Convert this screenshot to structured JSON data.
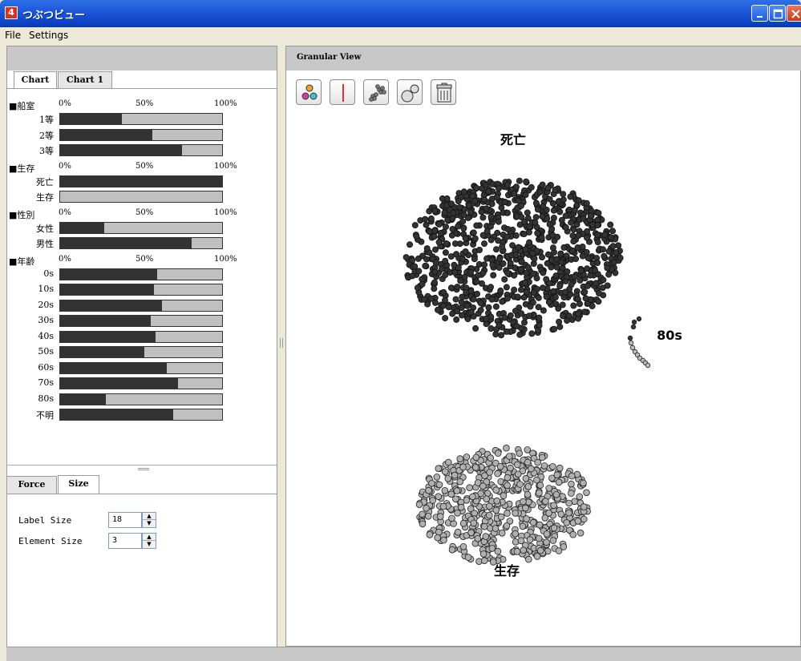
{
  "window": {
    "title": "つぶつビュー",
    "icon_glyph": "4"
  },
  "menu": [
    "File",
    "Settings"
  ],
  "chart_tabs": [
    "Chart",
    "Chart 1"
  ],
  "axis_ticks": [
    "0%",
    "50%",
    "100%"
  ],
  "colors": {
    "dark": "#333333",
    "light": "#c0c0c0",
    "accent_red": "#d9302a",
    "titlebar_blue": "#0a3fc0"
  },
  "chart_data": {
    "type": "bar",
    "stacked_percent": true,
    "xlim": [
      0,
      100
    ],
    "groups": [
      {
        "title": "■船室",
        "rows": [
          {
            "label": "1等",
            "value": 38
          },
          {
            "label": "2等",
            "value": 57
          },
          {
            "label": "3等",
            "value": 75
          }
        ]
      },
      {
        "title": "■生存",
        "rows": [
          {
            "label": "死亡",
            "value": 100
          },
          {
            "label": "生存",
            "value": 0
          }
        ]
      },
      {
        "title": "■性別",
        "rows": [
          {
            "label": "女性",
            "value": 27
          },
          {
            "label": "男性",
            "value": 81
          }
        ]
      },
      {
        "title": "■年齢",
        "rows": [
          {
            "label": "0s",
            "value": 60
          },
          {
            "label": "10s",
            "value": 58
          },
          {
            "label": "20s",
            "value": 63
          },
          {
            "label": "30s",
            "value": 56
          },
          {
            "label": "40s",
            "value": 59
          },
          {
            "label": "50s",
            "value": 52
          },
          {
            "label": "60s",
            "value": 66
          },
          {
            "label": "70s",
            "value": 73
          },
          {
            "label": "80s",
            "value": 28
          },
          {
            "label": "不明",
            "value": 70
          }
        ]
      }
    ]
  },
  "settings_tabs": [
    "Force",
    "Size"
  ],
  "settings": {
    "label_size": {
      "label": "Label Size",
      "value": "18"
    },
    "element_size": {
      "label": "Element Size",
      "value": "3"
    }
  },
  "right_panel": {
    "title": "Granular View"
  },
  "toolbar_icons": [
    "color-groups-icon",
    "divider-icon",
    "cluster-icon",
    "size-icon",
    "trash-icon"
  ],
  "clusters": [
    {
      "label": "死亡",
      "count": 950,
      "fill": "#333333"
    },
    {
      "label": "80s",
      "count": 12,
      "fill": "#555555"
    },
    {
      "label": "生存",
      "count": 540,
      "fill": "#b0b0b0"
    }
  ]
}
